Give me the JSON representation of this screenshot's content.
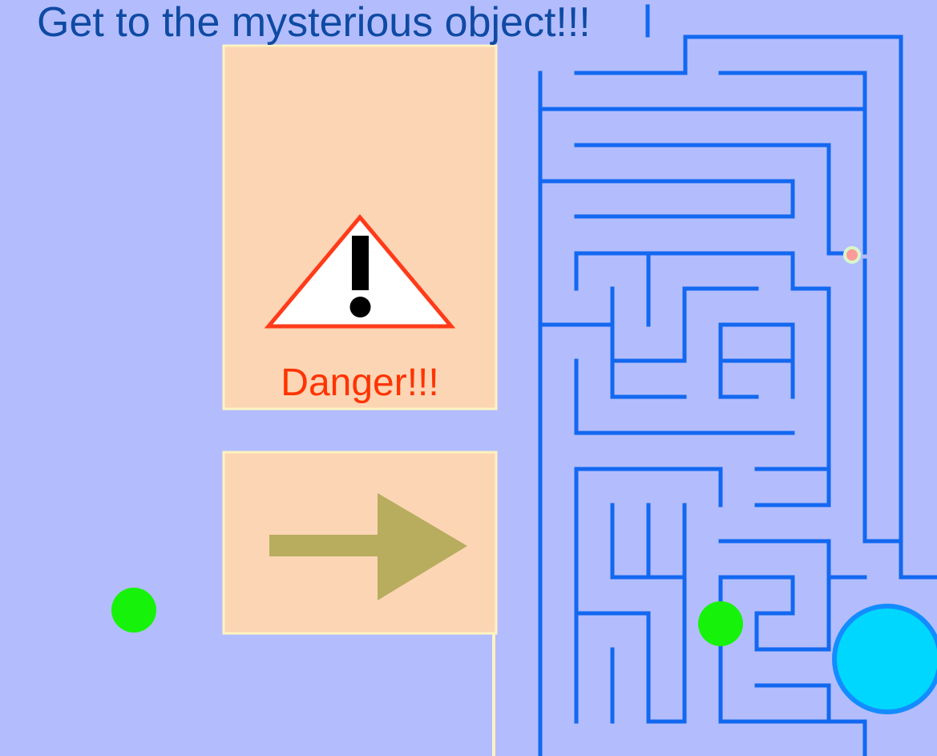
{
  "hud": {
    "message": "Get to the mysterious object!!!"
  },
  "warning_panel": {
    "label": "Danger!!!",
    "icon": "warning-triangle-icon"
  },
  "direction_panel": {
    "icon": "arrow-right-icon"
  },
  "colors": {
    "background": "#b3bdfd",
    "panel_fill": "#fcd5b5",
    "panel_border": "#fff3c0",
    "maze_wall": "#1368f0",
    "title_text": "#0f4aa3",
    "danger_text": "#ff3300",
    "warning_triangle_stroke": "#ff3b1a",
    "arrow": "#b8ad5e",
    "player": "#17f20a",
    "goal": "#00d7ff",
    "goal_border": "#148cff",
    "pink_dot": "#ff9a9a",
    "pink_dot_ring": "#d6f7c9"
  }
}
